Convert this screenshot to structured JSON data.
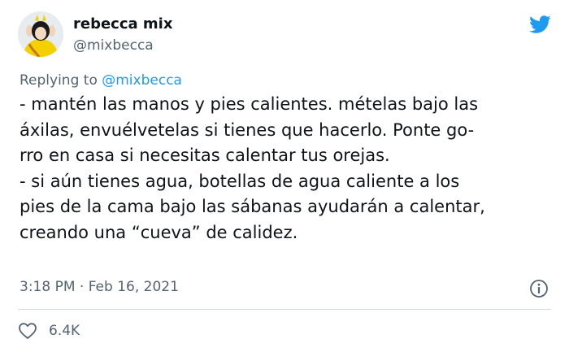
{
  "user": {
    "display_name": "rebecca mix",
    "handle": "@mixbecca"
  },
  "reply": {
    "prefix": "Replying to ",
    "mention": "@mixbecca"
  },
  "tweet": {
    "lines": [
      "- mantén las manos y pies calientes. mételas bajo las",
      "áxilas, envuélvetelas si tienes que hacerlo. Ponte go-",
      "rro en casa si necesitas calentar tus orejas.",
      "- si aún tienes agua, botellas de agua caliente a los",
      "pies de la cama bajo las sábanas ayudarán a calentar,",
      "creando una “cueva” de calidez."
    ],
    "timestamp": "3:18 PM · Feb 16, 2021",
    "like_count": "6.4K"
  },
  "icons": {
    "brand": "twitter-bird-icon",
    "info": "info-icon",
    "like": "heart-icon"
  },
  "colors": {
    "brand_blue": "#1d9bf0",
    "text_primary": "#0f1419",
    "text_secondary": "#536471",
    "divider": "#cfd9de",
    "avatar_yellow": "#f5d000"
  }
}
